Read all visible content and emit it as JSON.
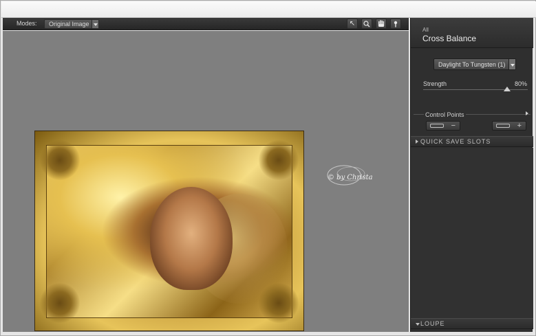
{
  "toolbar": {
    "modes_label": "Modes:",
    "modes_value": "Original Image",
    "tools": [
      {
        "name": "arrow-pointer-icon",
        "glyph": "↖"
      },
      {
        "name": "zoom-icon",
        "glyph": "🔍"
      },
      {
        "name": "hand-pan-icon",
        "glyph": "✋"
      },
      {
        "name": "eyedropper-icon",
        "glyph": "✦"
      }
    ]
  },
  "watermark": {
    "text": "© by Christa"
  },
  "panel": {
    "category": "All",
    "filter_title": "Cross Balance",
    "preset_value": "Daylight To Tungsten (1)",
    "strength_label": "Strength",
    "strength_value": "80%",
    "strength_fraction": 0.8,
    "control_points_label": "Control Points",
    "remove_point_symbol": "−",
    "add_point_symbol": "+",
    "quick_save_label": "QUICK SAVE SLOTS",
    "loupe_label": "LOUPE"
  },
  "colors": {
    "canvas_bg": "#7f7f7f",
    "panel_bg": "#2f2f2f",
    "photo_gold": "#e7c45a"
  }
}
